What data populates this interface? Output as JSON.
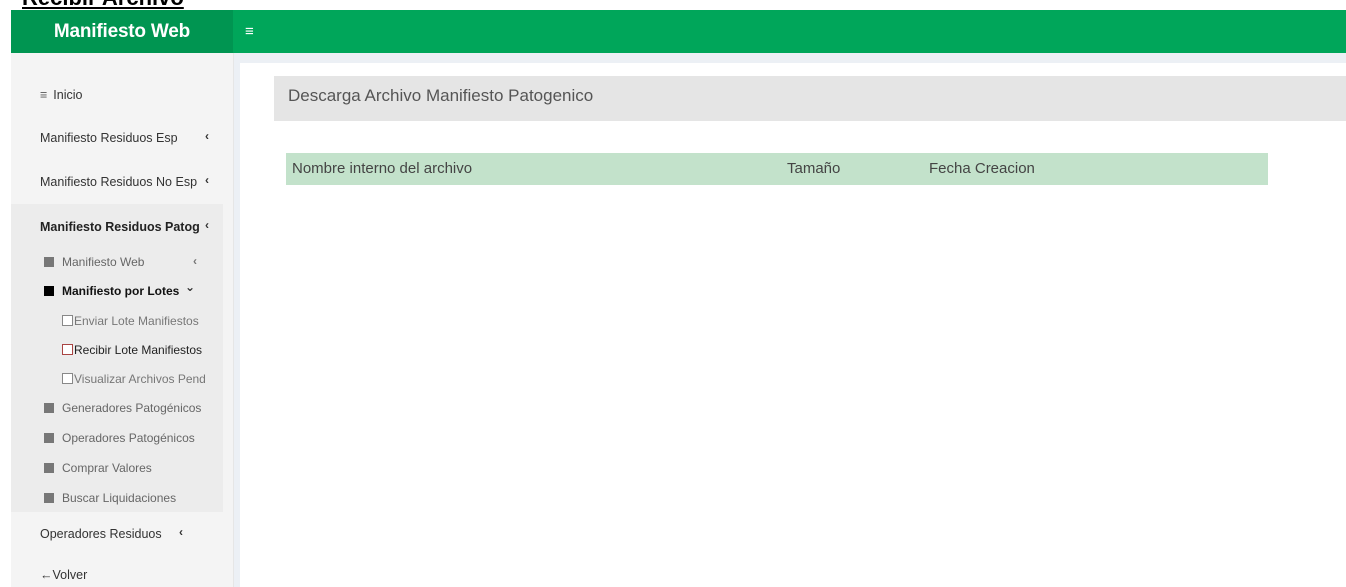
{
  "doc_caption": "Recibir Archivo",
  "brand": "Manifiesto Web",
  "hamburger_icon": "≡",
  "sidebar": {
    "inicio_icon": "≡",
    "inicio": "Inicio",
    "items": [
      {
        "label": "Manifiesto Residuos Esp"
      },
      {
        "label": "Manifiesto Residuos No Esp"
      },
      {
        "label": "Manifiesto Residuos Patog"
      }
    ],
    "patog_sub": [
      {
        "label": "Manifiesto Web"
      },
      {
        "label": "Manifiesto por Lotes"
      }
    ],
    "lotes_sub": [
      {
        "label": "Enviar Lote Manifiestos"
      },
      {
        "label": "Recibir Lote Manifiestos"
      },
      {
        "label": "Visualizar Archivos Pend"
      }
    ],
    "patog_sub2": [
      {
        "label": "Generadores Patogénicos"
      },
      {
        "label": "Operadores Patogénicos"
      },
      {
        "label": "Comprar Valores"
      },
      {
        "label": "Buscar Liquidaciones"
      }
    ],
    "operadores": "Operadores Residuos",
    "volver": "←Volver",
    "chev_left": "‹",
    "chev_down": "⌄"
  },
  "page_header": "Descarga Archivo Manifiesto Patogenico",
  "table": {
    "columns": [
      "Nombre interno del archivo",
      "Tamaño",
      "Fecha Creacion"
    ]
  }
}
